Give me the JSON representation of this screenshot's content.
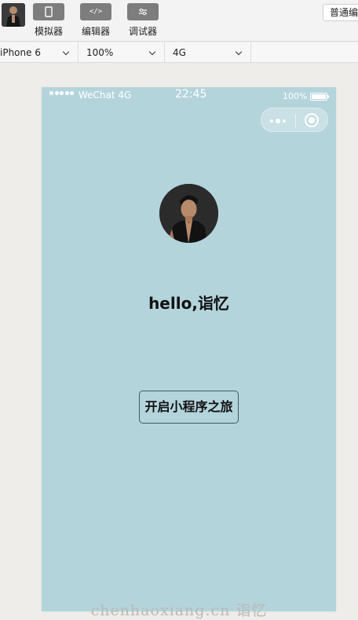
{
  "toolbar": {
    "tools": [
      {
        "glyph": "▯",
        "label": "模拟器"
      },
      {
        "glyph": "</>",
        "label": "编辑器"
      },
      {
        "glyph": "⚲",
        "label": "调试器"
      }
    ],
    "mode_label": "普通编"
  },
  "devicebar": {
    "device": "iPhone 6",
    "zoom": "100%",
    "network": "4G"
  },
  "phone": {
    "status": {
      "carrier": "WeChat 4G",
      "time": "22:45",
      "battery": "100%"
    },
    "greeting": "hello,诣忆",
    "start_button": "开启小程序之旅",
    "background_color": "#b4d4dc"
  },
  "watermark": "chenhaoxiang.cn 诣忆"
}
